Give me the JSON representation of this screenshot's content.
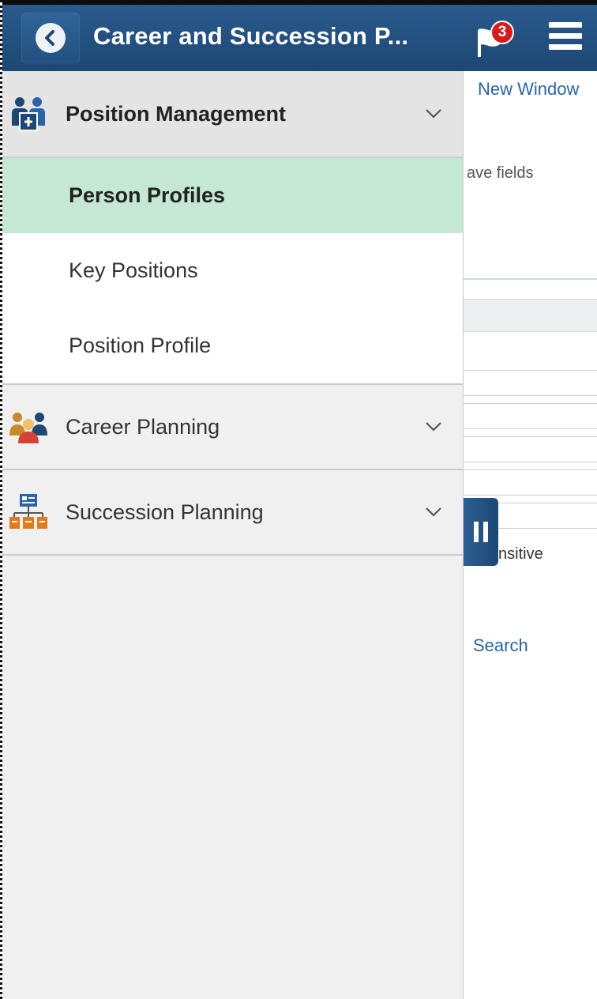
{
  "header": {
    "title": "Career and Succession P...",
    "notification_count": "3",
    "back_icon": "back-arrow-icon",
    "flag_icon": "notification-flag-icon",
    "menu_icon": "hamburger-menu-icon"
  },
  "background_page": {
    "new_window": "New Window",
    "save_fields_fragment": "ave fields",
    "sensitive_fragment": "nsitive",
    "search_fragment": "Search"
  },
  "nav": {
    "sections": [
      {
        "label": "Position Management",
        "icon": "position-management-icon",
        "expanded": true,
        "items": [
          {
            "label": "Person Profiles",
            "active": true
          },
          {
            "label": "Key Positions",
            "active": false
          },
          {
            "label": "Position Profile",
            "active": false
          }
        ]
      },
      {
        "label": "Career Planning",
        "icon": "career-planning-icon",
        "expanded": false
      },
      {
        "label": "Succession Planning",
        "icon": "succession-planning-icon",
        "expanded": false
      }
    ]
  },
  "colors": {
    "header_bg": "#1d4774",
    "active_item_bg": "#c4e8d3",
    "link": "#2a63a8",
    "badge": "#d31d1d"
  }
}
